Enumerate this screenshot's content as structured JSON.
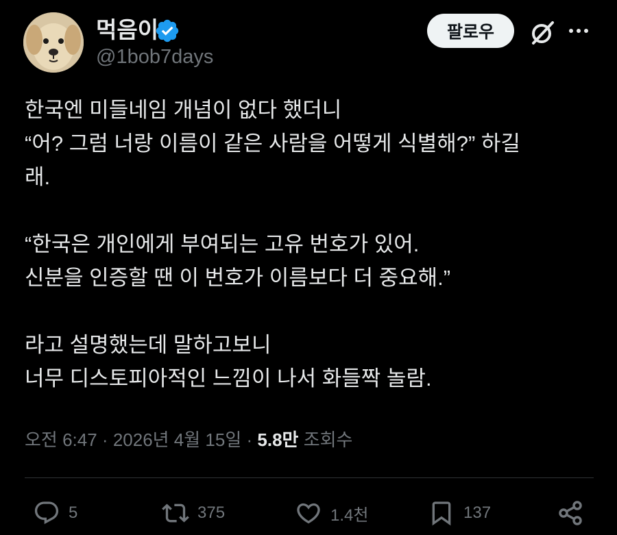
{
  "author": {
    "display_name": "먹음이",
    "handle": "@1bob7days",
    "verified_icon": "verified-badge-icon",
    "avatar": "puppy-avatar"
  },
  "header": {
    "follow_label": "팔로우",
    "grok_icon": "grok-icon",
    "more_icon": "more-icon"
  },
  "tweet": {
    "lines": [
      "한국엔 미들네임 개념이 없다 했더니",
      "“어? 그럼 너랑 이름이 같은 사람을 어떻게 식별해?” 하길",
      "래.",
      "",
      "“한국은 개인에게 부여되는 고유 번호가 있어.",
      "신분을 인증할 땐 이 번호가 이름보다 더 중요해.”",
      "",
      "라고 설명했는데 말하고보니",
      "너무 디스토피아적인 느낌이 나서 화들짝 놀람."
    ]
  },
  "meta": {
    "time": "오전 6:47",
    "separator": "·",
    "date": "2026년 4월 15일",
    "views_count": "5.8만",
    "views_label": "조회수"
  },
  "actions": {
    "replies": "5",
    "reposts": "375",
    "likes": "1.4천",
    "bookmarks": "137"
  },
  "colors": {
    "background": "#000000",
    "text": "#e7e9ea",
    "muted": "#71767b",
    "verified": "#1d9bf0",
    "divider": "#2f3336"
  }
}
